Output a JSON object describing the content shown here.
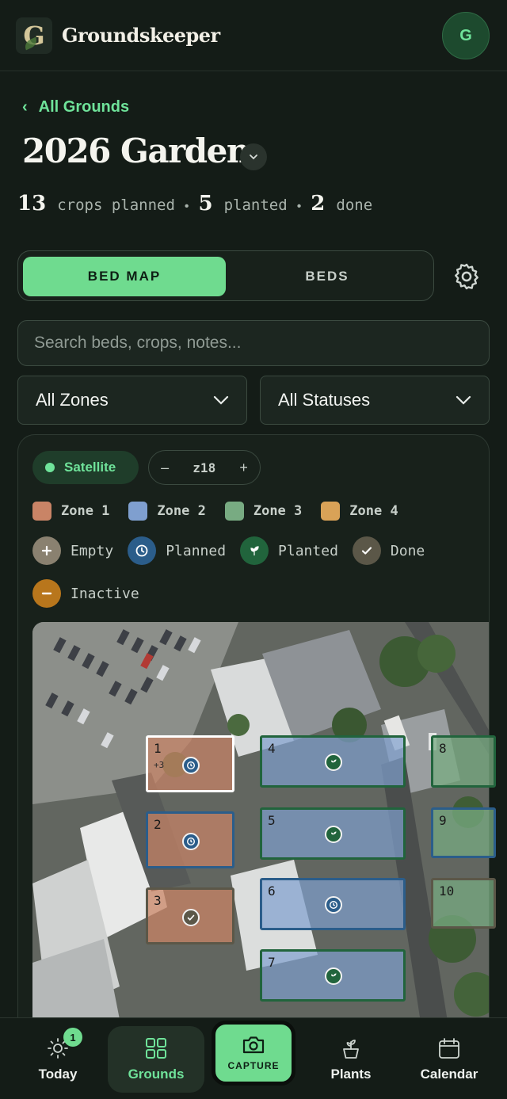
{
  "app": {
    "title": "Groundskeeper",
    "logo_letter": "G",
    "avatar_initial": "G"
  },
  "nav_back": {
    "label": "All Grounds"
  },
  "page": {
    "title": "2026 Garden"
  },
  "stats": {
    "planned_count": "13",
    "planned_label": "crops planned",
    "planted_count": "5",
    "planted_label": "planted",
    "done_count": "2",
    "done_label": "done"
  },
  "view_toggle": {
    "active": "BED MAP",
    "inactive": "BEDS"
  },
  "search": {
    "placeholder": "Search beds, crops, notes..."
  },
  "filters": {
    "zones": "All Zones",
    "statuses": "All Statuses"
  },
  "map_controls": {
    "layer": "Satellite",
    "zoom_level": "z18",
    "zoom_out": "–",
    "zoom_in": "+"
  },
  "zones": [
    {
      "label": "Zone 1",
      "color": "#c98466"
    },
    {
      "label": "Zone 2",
      "color": "#7f9fcf"
    },
    {
      "label": "Zone 3",
      "color": "#78ab82"
    },
    {
      "label": "Zone 4",
      "color": "#d9a257"
    }
  ],
  "statuses": [
    {
      "label": "Empty",
      "color": "#8a8170",
      "icon": "plus-icon"
    },
    {
      "label": "Planned",
      "color": "#2b5d8a",
      "icon": "clock-icon"
    },
    {
      "label": "Planted",
      "color": "#21643c",
      "icon": "sprout-icon"
    },
    {
      "label": "Done",
      "color": "#5b5748",
      "icon": "check-icon"
    },
    {
      "label": "Inactive",
      "color": "#b8761c",
      "icon": "minus-icon"
    }
  ],
  "beds": [
    {
      "num": "1",
      "extra": "+3",
      "status": "planned",
      "zone": "1",
      "selected": true
    },
    {
      "num": "2",
      "status": "planned",
      "zone": "1"
    },
    {
      "num": "3",
      "status": "done",
      "zone": "1"
    },
    {
      "num": "4",
      "status": "planted",
      "zone": "2"
    },
    {
      "num": "5",
      "status": "planted",
      "zone": "2"
    },
    {
      "num": "6",
      "status": "planned",
      "zone": "2"
    },
    {
      "num": "7",
      "status": "planted",
      "zone": "2"
    },
    {
      "num": "8",
      "zone": "3"
    },
    {
      "num": "9",
      "zone": "3"
    },
    {
      "num": "10",
      "zone": "3"
    }
  ],
  "bottom_nav": {
    "today": "Today",
    "today_badge": "1",
    "grounds": "Grounds",
    "capture": "CAPTURE",
    "plants": "Plants",
    "calendar": "Calendar"
  }
}
